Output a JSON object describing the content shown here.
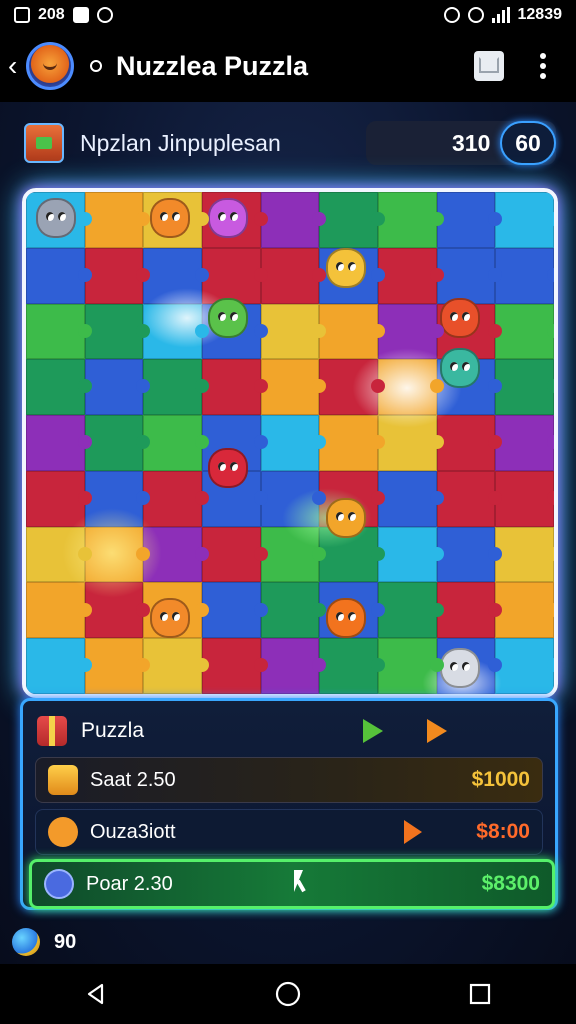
{
  "status_bar": {
    "left_text": "208",
    "right_text": "12839"
  },
  "app_bar": {
    "title": "Nuzzlea Puzzla",
    "back_icon": "chevron-left-icon",
    "mail_icon": "mail-icon",
    "menu_icon": "more-vert-icon"
  },
  "level": {
    "name": "Npzlan Jinpuplesan",
    "score": "310",
    "count": "60"
  },
  "board": {
    "rows": 9,
    "cols": 9,
    "colors": [
      "#2ab8e8",
      "#c8253c",
      "#3dbb4a",
      "#f2a52a",
      "#8d2fb8",
      "#2f5fd6",
      "#e8c238",
      "#1e9a5a"
    ]
  },
  "panel": {
    "title": "Puzzla",
    "options": [
      {
        "label": "Saat 2.50",
        "value": "$1000",
        "icon": "gift-box-icon"
      },
      {
        "label": "Ouza3iott",
        "value": "$8:00",
        "icon": "creature-face-icon"
      },
      {
        "label": "Poar 2.30",
        "value": "$8300",
        "icon": "blob-creature-icon"
      }
    ]
  },
  "footer": {
    "coins": "90"
  },
  "nav": {
    "back": "nav-back-icon",
    "home": "nav-home-icon",
    "recents": "nav-recents-icon"
  },
  "accent_colors": {
    "board_glow": "#9b6bff",
    "panel_border": "#39a7ff",
    "selected_row": "#55f06a"
  }
}
